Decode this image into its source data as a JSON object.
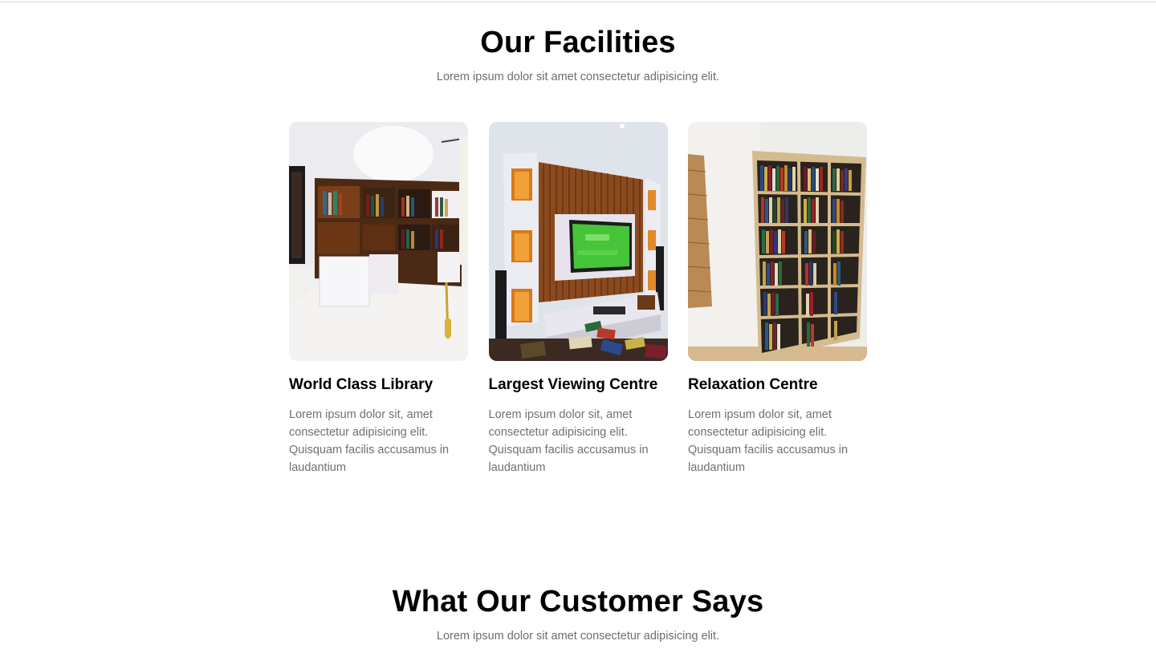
{
  "facilities": {
    "title": "Our Facilities",
    "subtitle": "Lorem ipsum dolor sit amet consectetur adipisicing elit.",
    "cards": [
      {
        "title": "World Class Library",
        "text": "Lorem ipsum dolor sit, amet consectetur adipisicing elit. Quisquam facilis accusamus in laudantium",
        "image": "library-corner-shelves-photo"
      },
      {
        "title": "Largest Viewing Centre",
        "text": "Lorem ipsum dolor sit, amet consectetur adipisicing elit. Quisquam facilis accusamus in laudantium",
        "image": "tv-wall-unit-photo"
      },
      {
        "title": "Relaxation Centre",
        "text": "Lorem ipsum dolor sit, amet consectetur adipisicing elit. Quisquam facilis accusamus in laudantium",
        "image": "tall-bookcase-photo"
      }
    ]
  },
  "testimonials": {
    "title": "What Our Customer Says",
    "subtitle": "Lorem ipsum dolor sit amet consectetur adipisicing elit."
  },
  "colors": {
    "heading": "#000000",
    "body_text": "#707070",
    "divider": "#d9d9d9",
    "wood": "#8a4b1c"
  }
}
